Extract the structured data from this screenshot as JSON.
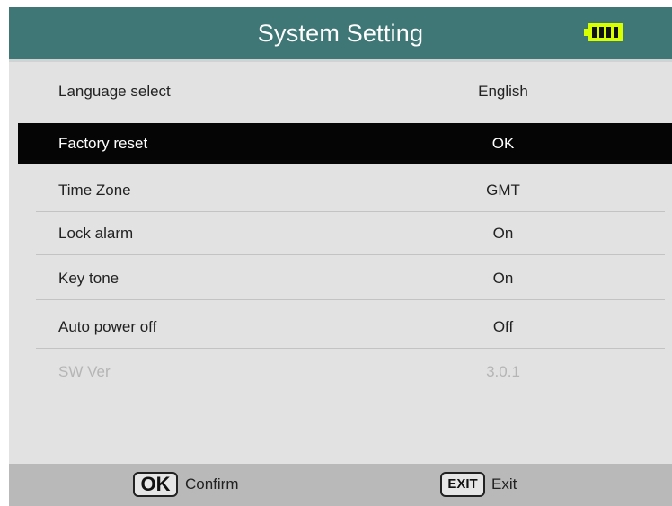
{
  "header": {
    "title": "System Setting",
    "battery_icon": "battery-full-icon",
    "background_color": "#3e7775"
  },
  "settings": [
    {
      "label": "Language select",
      "value": "English",
      "state": "normal"
    },
    {
      "label": "Factory reset",
      "value": "OK",
      "state": "selected"
    },
    {
      "label": "Time Zone",
      "value": "GMT",
      "state": "normal"
    },
    {
      "label": "Lock alarm",
      "value": "On",
      "state": "normal"
    },
    {
      "label": "Key tone",
      "value": "On",
      "state": "normal"
    },
    {
      "label": "Auto power off",
      "value": "Off",
      "state": "normal"
    },
    {
      "label": "SW Ver",
      "value": "3.0.1",
      "state": "disabled"
    }
  ],
  "footer": {
    "ok_key": "OK",
    "ok_label": "Confirm",
    "exit_key": "EXIT",
    "exit_label": "Exit"
  }
}
